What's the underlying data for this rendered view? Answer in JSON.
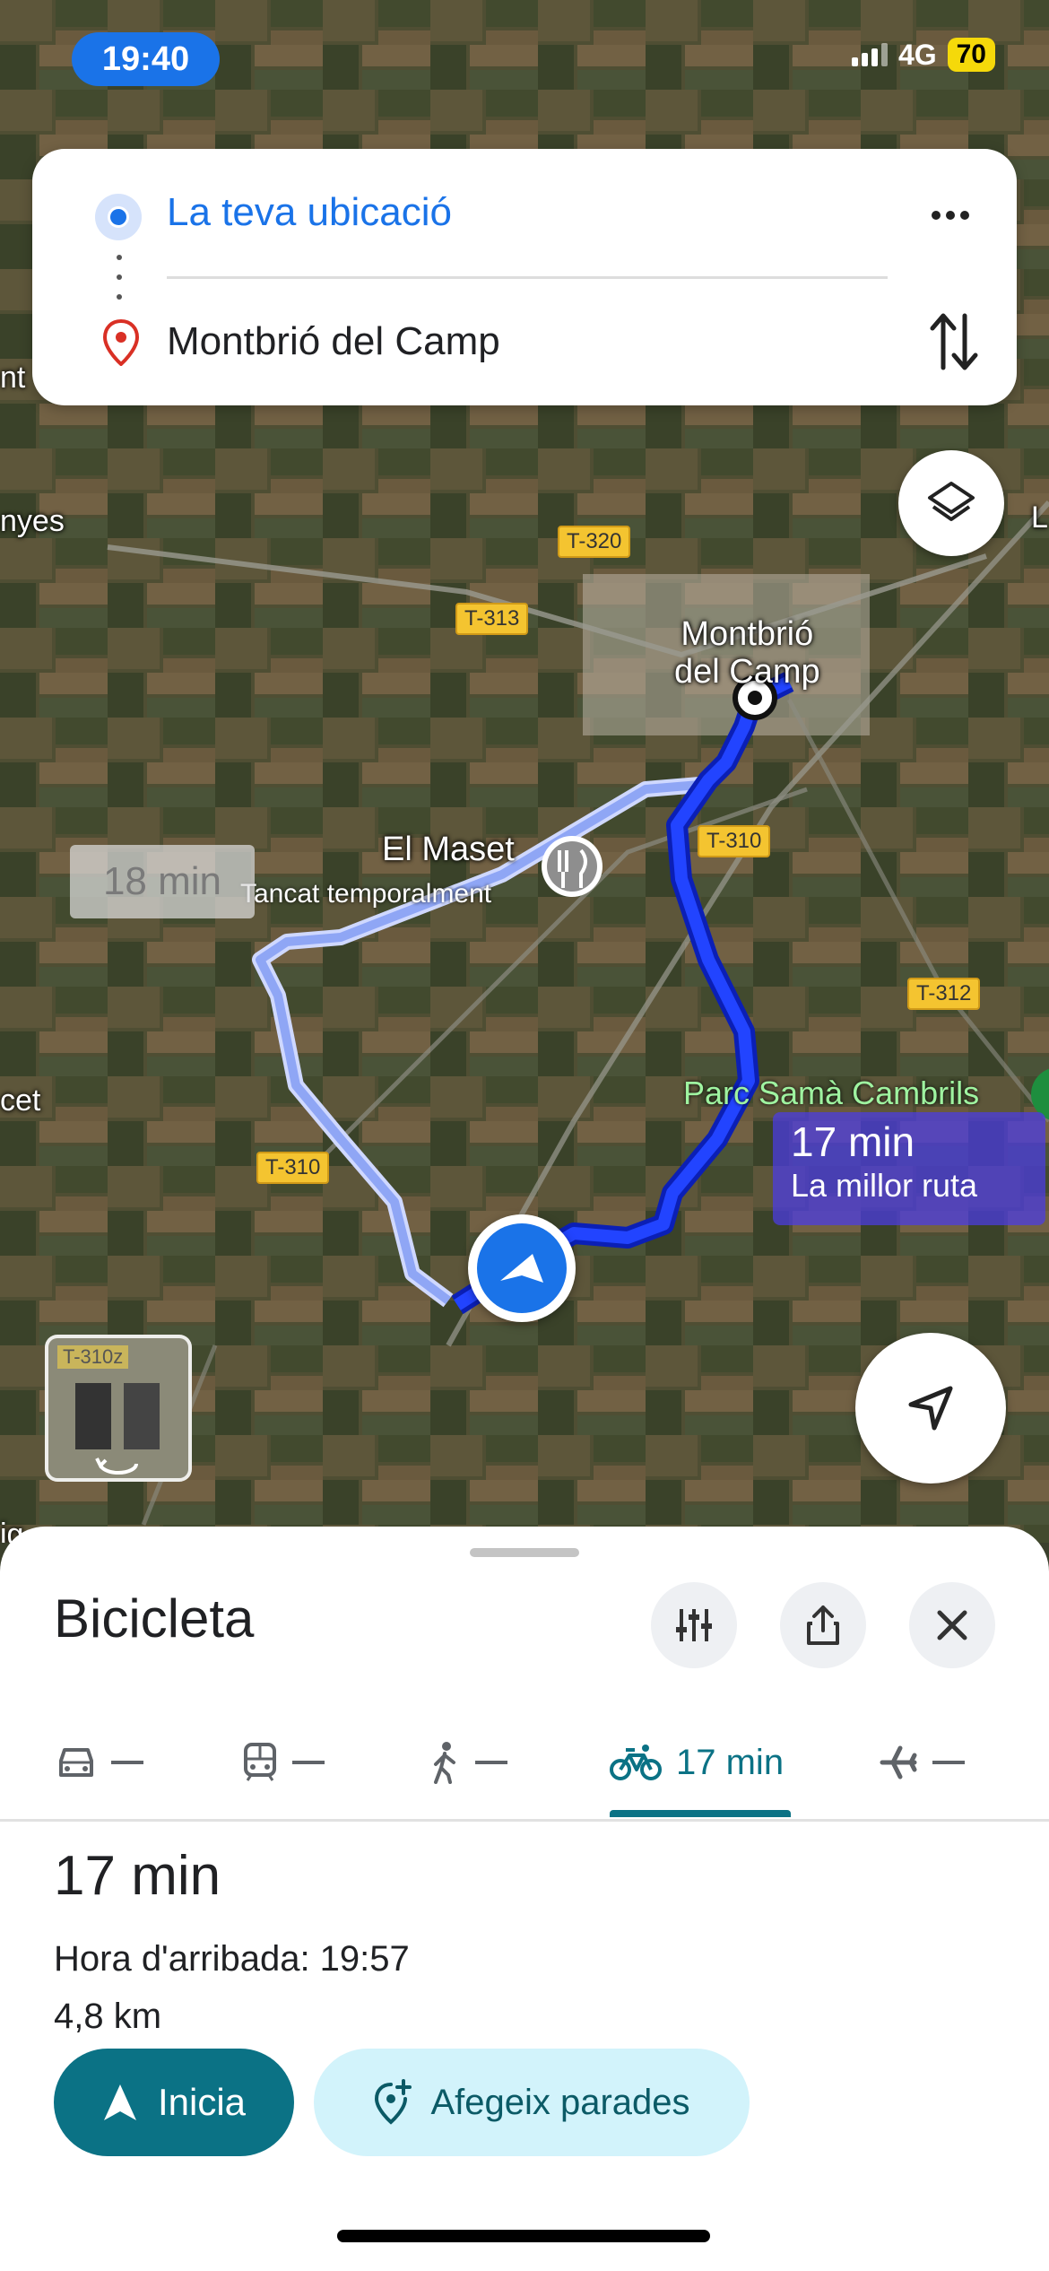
{
  "status_bar": {
    "time": "19:40",
    "network": "4G",
    "battery": "70"
  },
  "directions": {
    "origin": "La teva ubicació",
    "destination": "Montbrió del Camp"
  },
  "map": {
    "roads": [
      "T-320",
      "T-313",
      "T-310",
      "T-312",
      "T-310",
      "T-310z"
    ],
    "places": {
      "town": [
        "Montbrió",
        "del Camp"
      ],
      "restaurant": "El Maset",
      "restaurant_status": "Tancat temporalment",
      "park": "Parc Samà Cambrils",
      "edge_left_1": "nyes",
      "edge_left_2": "cet",
      "edge_left_3": "ig",
      "edge_left_4": "nt",
      "edge_right": "L"
    },
    "alt_route_eta": "18 min",
    "best_route_eta": "17 min",
    "best_route_label": "La millor ruta"
  },
  "sheet": {
    "mode_title": "Bicicleta",
    "tabs": [
      {
        "icon": "car-icon",
        "value": ""
      },
      {
        "icon": "transit-icon",
        "value": ""
      },
      {
        "icon": "walk-icon",
        "value": ""
      },
      {
        "icon": "bike-icon",
        "value": "17 min"
      },
      {
        "icon": "flight-icon",
        "value": ""
      }
    ],
    "summary_time": "17 min",
    "arrival": "Hora d'arribada: 19:57",
    "distance": "4,8 km",
    "start_label": "Inicia",
    "add_stops_label": "Afegeix parades"
  },
  "colors": {
    "accent": "#1a73e8",
    "teal": "#0b7285",
    "route": "#1a3cf0"
  }
}
